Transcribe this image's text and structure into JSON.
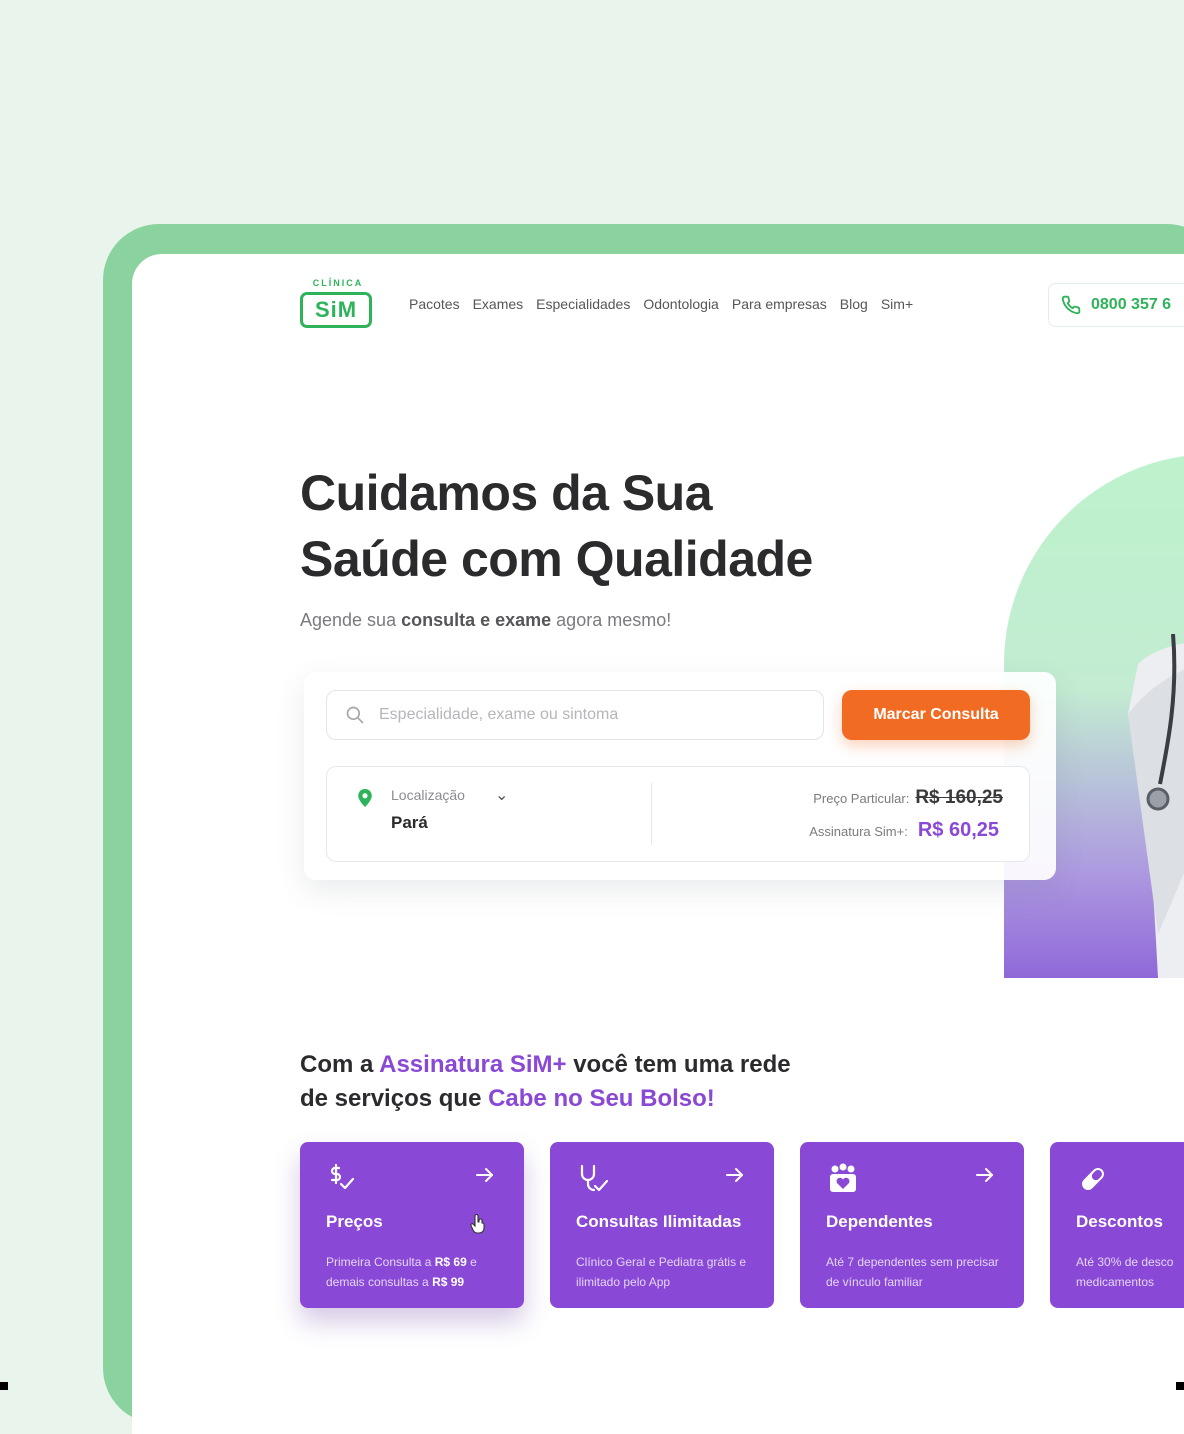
{
  "logo": {
    "top": "CLÍNICA",
    "main": "SiM"
  },
  "nav": {
    "items": [
      "Pacotes",
      "Exames",
      "Especialidades",
      "Odontologia",
      "Para empresas",
      "Blog",
      "Sim+"
    ]
  },
  "phone": {
    "number": "0800 357 6"
  },
  "hero": {
    "title_line1": "Cuidamos da Sua",
    "title_line2": "Saúde com Qualidade",
    "subtitle_pre": "Agende sua ",
    "subtitle_bold": "consulta e exame",
    "subtitle_post": " agora mesmo!"
  },
  "search": {
    "placeholder": "Especialidade, exame ou sintoma",
    "button": "Marcar Consulta"
  },
  "location": {
    "label": "Localização",
    "value": "Pará"
  },
  "prices": {
    "private_label": "Preço Particular:",
    "private_value": "R$ 160,25",
    "subscription_label": "Assinatura Sim+:",
    "subscription_value": "R$ 60,25"
  },
  "section": {
    "t1": "Com a ",
    "t2": "Assinatura SiM+",
    "t3": " você tem uma rede",
    "t4": "de serviços que ",
    "t5": "Cabe no Seu Bolso!"
  },
  "cards": [
    {
      "icon": "dollar-check-icon",
      "title": "Preços",
      "d1": "Primeira Consulta a ",
      "d2": "R$ 69",
      "d3": " e demais consultas a ",
      "d4": "R$ 99"
    },
    {
      "icon": "stethoscope-icon",
      "title": "Consultas Ilimitadas",
      "d1": "Clínico Geral e Pediatra grátis e ilimitado pelo App"
    },
    {
      "icon": "family-heart-icon",
      "title": "Dependentes",
      "d1": "Até 7 dependentes sem precisar de vínculo familiar"
    },
    {
      "icon": "pill-icon",
      "title": "Descontos",
      "d1": "Até 30% de desco",
      "d2": "medicamentos"
    }
  ],
  "colors": {
    "brand_green": "#2eb35a",
    "frame_green": "#8ad39e",
    "purple": "#8a48d6",
    "orange": "#f26b22"
  }
}
